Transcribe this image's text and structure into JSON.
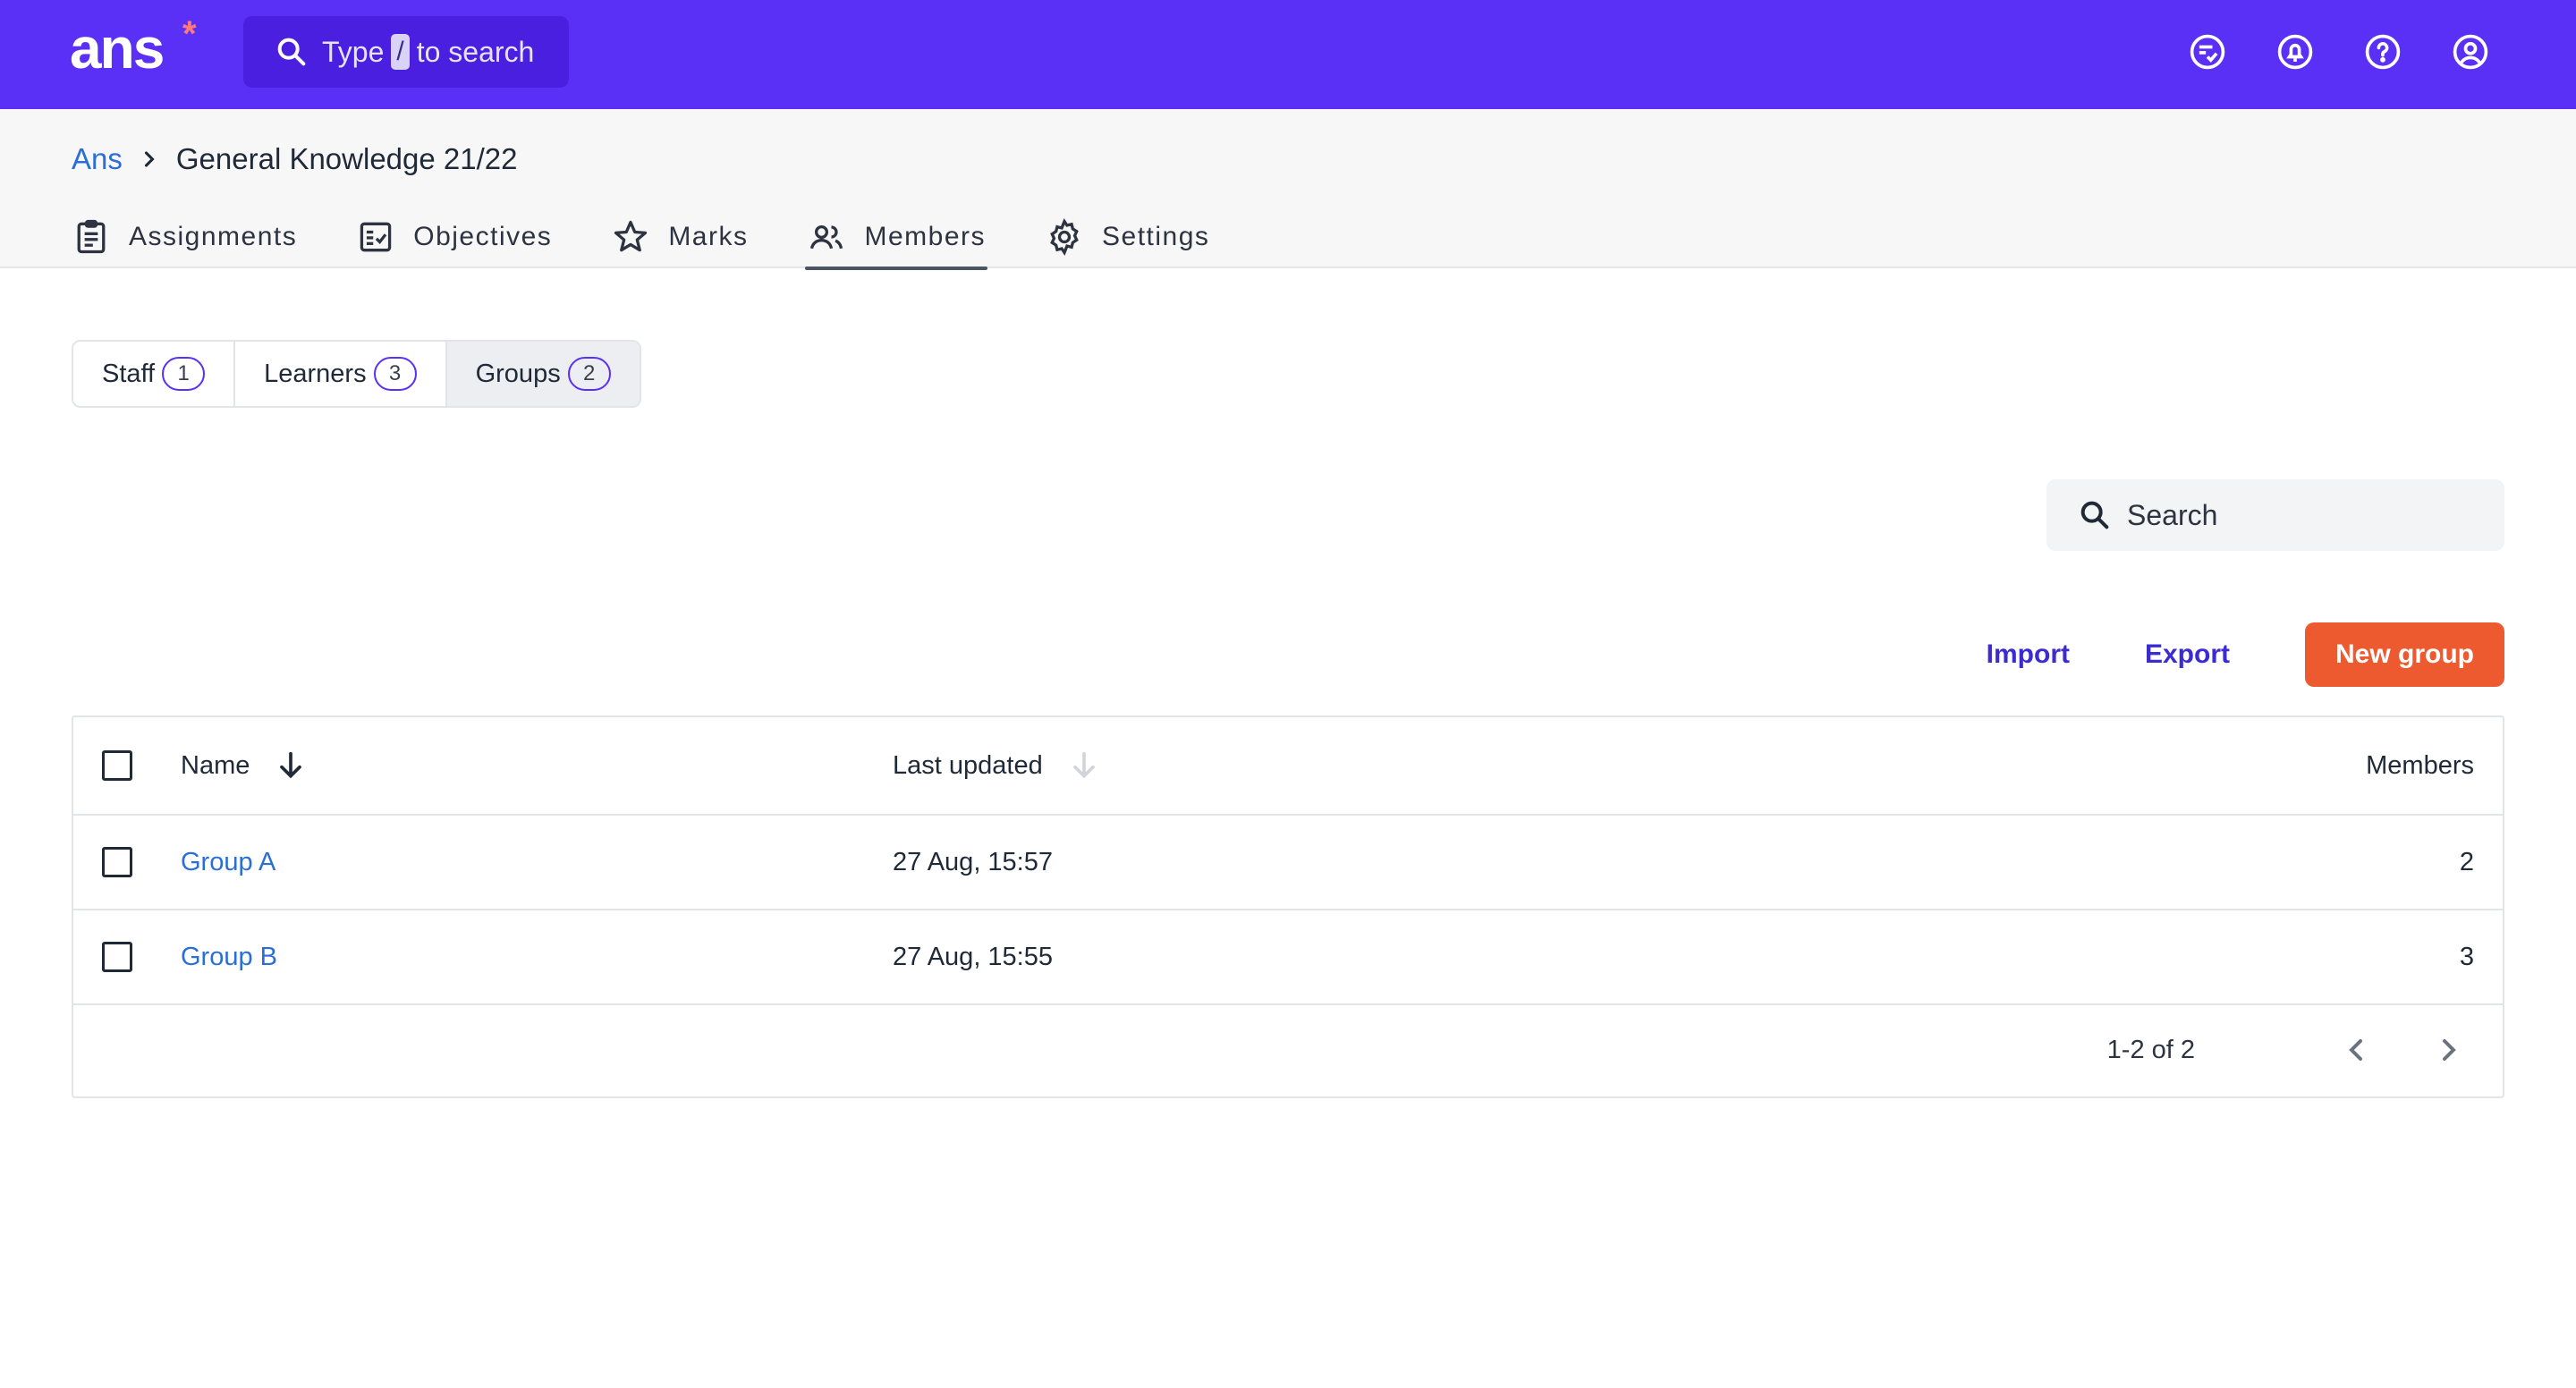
{
  "app": {
    "logo": "ans",
    "logo_mark": "*",
    "search": {
      "prefix": "Type",
      "key": "/",
      "suffix": "to search"
    },
    "top_icons": [
      "comments-check-icon",
      "notifications-bell-icon",
      "help-icon",
      "account-icon"
    ]
  },
  "breadcrumb": {
    "root": "Ans",
    "current": "General Knowledge 21/22"
  },
  "nav_tabs": [
    {
      "label": "Assignments",
      "icon": "clipboard-icon"
    },
    {
      "label": "Objectives",
      "icon": "checklist-icon"
    },
    {
      "label": "Marks",
      "icon": "star-icon"
    },
    {
      "label": "Members",
      "icon": "people-icon",
      "active": true
    },
    {
      "label": "Settings",
      "icon": "gear-icon"
    }
  ],
  "segments": [
    {
      "label": "Staff",
      "count": "1"
    },
    {
      "label": "Learners",
      "count": "3"
    },
    {
      "label": "Groups",
      "count": "2",
      "active": true
    }
  ],
  "search": {
    "placeholder": "Search"
  },
  "actions": {
    "import": "Import",
    "export": "Export",
    "new_group": "New group"
  },
  "table": {
    "columns": {
      "name": "Name",
      "updated": "Last updated",
      "members": "Members"
    },
    "rows": [
      {
        "name": "Group A",
        "updated": "27 Aug, 15:57",
        "members": "2"
      },
      {
        "name": "Group B",
        "updated": "27 Aug, 15:55",
        "members": "3"
      }
    ],
    "pagination": "1-2 of 2"
  },
  "colors": {
    "brand": "#5b30f6",
    "accent": "#ee5a2f",
    "link": "#2b6fd6"
  }
}
